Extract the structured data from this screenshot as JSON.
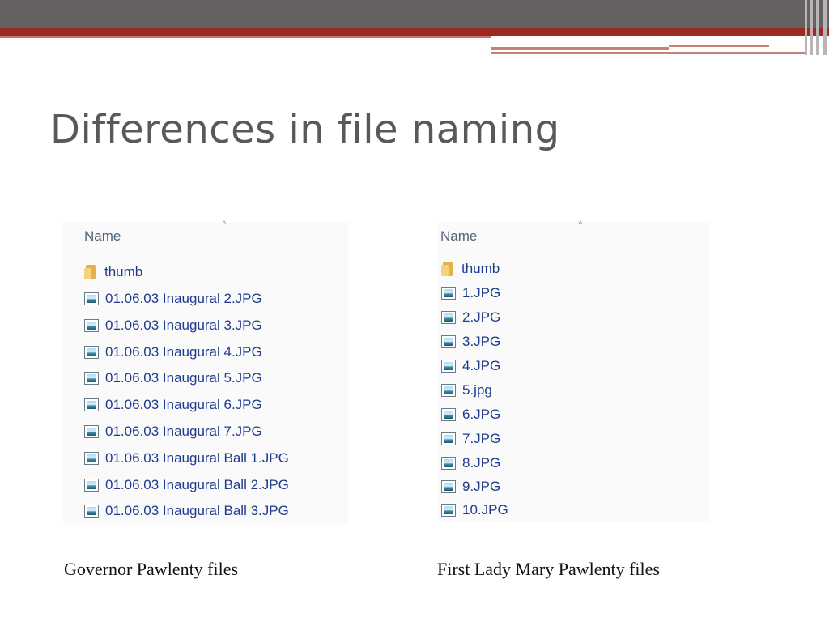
{
  "slide": {
    "title": "Differences in file naming"
  },
  "left_panel": {
    "header": "Name",
    "folder": {
      "label": "thumb",
      "icon": "folder-icon"
    },
    "files": [
      "01.06.03 Inaugural 2.JPG",
      "01.06.03 Inaugural 3.JPG",
      "01.06.03 Inaugural 4.JPG",
      "01.06.03 Inaugural 5.JPG",
      "01.06.03 Inaugural 6.JPG",
      "01.06.03 Inaugural 7.JPG",
      "01.06.03 Inaugural Ball 1.JPG",
      "01.06.03 Inaugural Ball 2.JPG",
      "01.06.03 Inaugural Ball 3.JPG"
    ],
    "caption": "Governor Pawlenty files"
  },
  "right_panel": {
    "header": "Name",
    "folder": {
      "label": "thumb",
      "icon": "folder-icon"
    },
    "files": [
      "1.JPG",
      "2.JPG",
      "3.JPG",
      "4.JPG",
      "5.jpg",
      "6.JPG",
      "7.JPG",
      "8.JPG",
      "9.JPG",
      "10.JPG"
    ],
    "caption": "First Lady Mary Pawlenty files"
  },
  "colors": {
    "banner_dark": "#666163",
    "banner_red": "#9b2b21",
    "title_text": "#58595b",
    "file_text": "#1f3b8f"
  }
}
